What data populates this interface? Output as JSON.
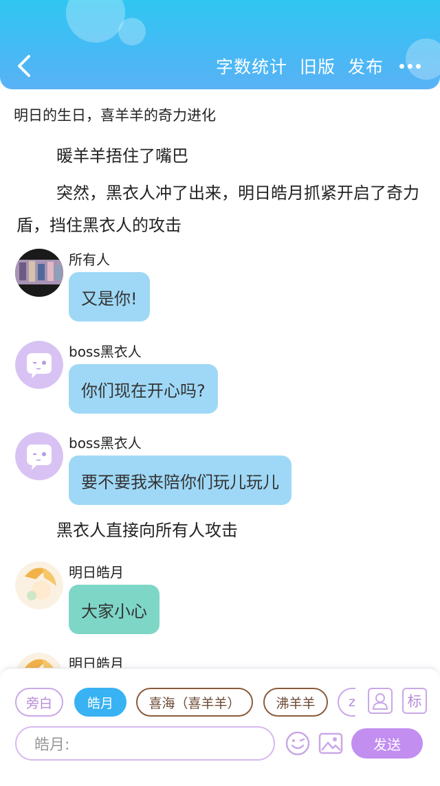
{
  "header": {
    "word_count": "字数统计",
    "old_version": "旧版",
    "publish": "发布"
  },
  "story": {
    "title": "明日的生日，喜羊羊的奇力进化",
    "narration_1": "暖羊羊捂住了嘴巴",
    "narration_2": "突然，黑衣人冲了出来，明日皓月抓紧开启了奇力盾，挡住黑衣人的攻击",
    "narration_3": "黑衣人直接向所有人攻击"
  },
  "messages": [
    {
      "speaker": "所有人",
      "text": "又是你!"
    },
    {
      "speaker": "boss黑衣人",
      "text": "你们现在开心吗?"
    },
    {
      "speaker": "boss黑衣人",
      "text": "要不要我来陪你们玩儿玩儿"
    },
    {
      "speaker": "明日皓月",
      "text": "大家小心"
    },
    {
      "speaker": "明日皓月",
      "text": ""
    }
  ],
  "composer": {
    "roles": [
      "旁白",
      "皓月",
      "喜海（喜羊羊）",
      "沸羊羊",
      "z"
    ],
    "active_role": "皓月",
    "mark_label": "标",
    "input_placeholder": "皓月:",
    "send_label": "发送"
  },
  "colors": {
    "header": "#45BAF4",
    "bubble_blue": "#9FD8F6",
    "bubble_teal": "#7ED6C7",
    "accent_purple": "#C28EF0"
  },
  "icons": [
    "back-icon",
    "more-icon",
    "avatar-icon",
    "emoji-icon",
    "image-icon",
    "user-icon"
  ]
}
